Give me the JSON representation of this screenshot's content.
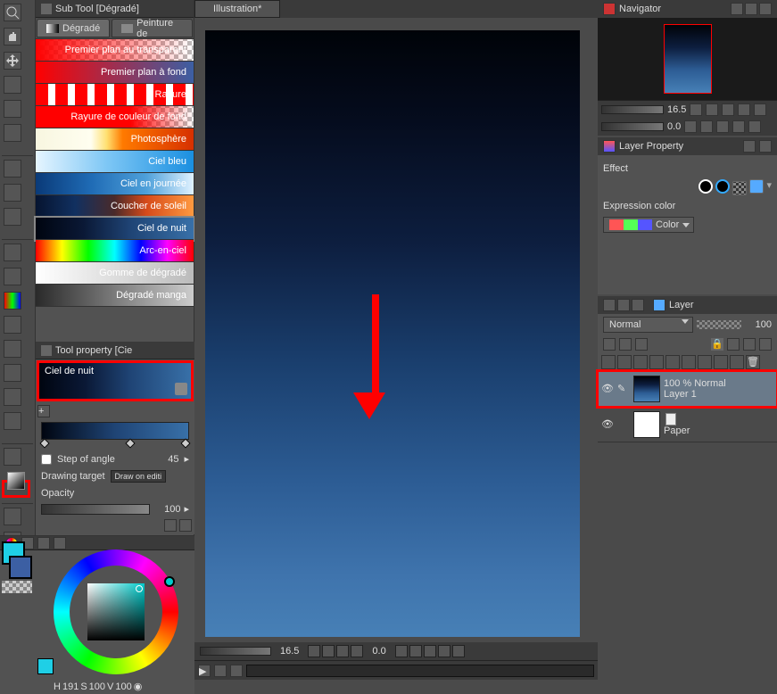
{
  "subtool": {
    "title": "Sub Tool [Dégradé]",
    "tabs": [
      {
        "label": "Dégradé",
        "active": true
      },
      {
        "label": "Peinture de"
      }
    ],
    "gradients": [
      {
        "label": "Premier plan au transparent",
        "css": "linear-gradient(90deg, #ff0000 0%, rgba(255,0,0,0) 100%), repeating-conic-gradient(#bbb 0 25%, #fff 0 50%) 0/10px 10px"
      },
      {
        "label": "Premier plan à fond",
        "css": "linear-gradient(90deg, #ff0000 0%, #3c5fa3 100%)"
      },
      {
        "label": "Rayure",
        "css": "repeating-linear-gradient(90deg, #ff0000 0 14px, #fff 14px 22px)"
      },
      {
        "label": "Rayure de couleur de fond",
        "css": "linear-gradient(90deg, #ff0000 0%, #ff0000 60%, rgba(255,0,0,0) 100%), repeating-conic-gradient(#bbb 0 25%, #fff 0 50%) 0/10px 10px"
      },
      {
        "label": "Photosphère",
        "css": "linear-gradient(90deg, #f8f6e0 0%, #fffef0 35%, #ffe070 45%, #ff7a00 55%, #d63000 100%)"
      },
      {
        "label": "Ciel bleu",
        "css": "linear-gradient(90deg, #e6f5ff 0%, #7ec7f5 45%, #1a8fe0 100%)"
      },
      {
        "label": "Ciel en journée",
        "css": "linear-gradient(90deg, #0a3a78 0%, #1f6bb5 35%, #4ea0da 70%, #e0f2ff 100%)"
      },
      {
        "label": "Coucher de soleil",
        "css": "linear-gradient(90deg, #061430 0%, #113060 25%, #4a2a2a 50%, #d64a1a 70%, #ff9a40 100%)"
      },
      {
        "label": "Ciel de nuit",
        "css": "linear-gradient(90deg, #000510 0%, #0a1835 30%, #1f4475 60%, #3870a8 100%)",
        "selected": true
      },
      {
        "label": "Arc-en-ciel",
        "css": "linear-gradient(90deg, #ff0000, #ffff00, #00ff00, #00ffff, #0000ff, #ff00ff, #ff0000)"
      },
      {
        "label": "Gomme de dégradé",
        "css": "linear-gradient(90deg, #ffffff, #bbbbbb)"
      },
      {
        "label": "Dégradé manga",
        "css": "linear-gradient(90deg, #2a2a2a, #cccccc)"
      }
    ]
  },
  "toolprop": {
    "title": "Tool property [Cie",
    "selected_name": "Ciel de nuit",
    "step_of_angle": {
      "label": "Step of angle",
      "value": 45
    },
    "drawing_target": {
      "label": "Drawing target",
      "value": "Draw on editi"
    },
    "opacity": {
      "label": "Opacity",
      "value": 100
    }
  },
  "color": {
    "main_swatch": "#1fcfe6",
    "sub_swatch": "#1fcfe6",
    "readout": {
      "H": 191,
      "S": 100,
      "V": 100
    },
    "eyedropper_icon": "◉"
  },
  "document": {
    "tab_label": "Illustration*",
    "zoom": "16.5",
    "rotation": "0.0"
  },
  "navigator": {
    "title": "Navigator",
    "zoom": "16.5",
    "rotation": "0.0"
  },
  "layer_property": {
    "title": "Layer Property",
    "effect_label": "Effect",
    "expression_label": "Expression color",
    "expression_value": "Color"
  },
  "layer": {
    "title": "Layer",
    "blend_mode": "Normal",
    "opacity": 100,
    "layers": [
      {
        "name": "Layer 1",
        "opacity_mode": "100 % Normal",
        "selected": true,
        "highlighted": true,
        "thumb_css": "linear-gradient(180deg,#000308,#0d1e3f,#2d5d95,#4780b6)"
      },
      {
        "name": "Paper",
        "thumb_css": "#ffffff",
        "paper": true
      }
    ]
  }
}
